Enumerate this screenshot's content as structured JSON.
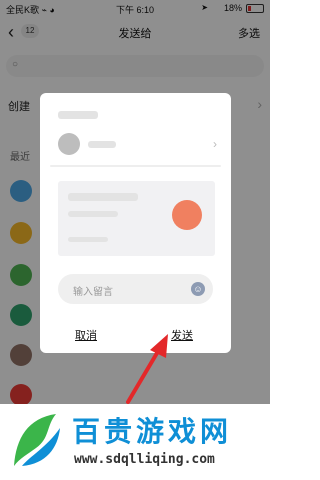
{
  "status_bar": {
    "carrier": "全民K歌 ⌁ ◕",
    "time": "下午 6:10",
    "battery": "18%"
  },
  "nav": {
    "back_icon": "chevron-left-icon",
    "badge_count": "12",
    "title": "发送给",
    "multi_select": "多选"
  },
  "list": {
    "create_label": "创建",
    "recent_label": "最近",
    "avatar_colors": [
      "#4aa3df",
      "#f0b429",
      "#4caf50",
      "#2e9e6a",
      "#8d6e63",
      "#e53935"
    ]
  },
  "dialog": {
    "message_placeholder": "输入留言",
    "cancel_label": "取消",
    "send_label": "发送"
  },
  "watermark": {
    "title": "百贵游戏网",
    "url": "www.sdqlliqing.com"
  },
  "colors": {
    "arrow": "#e3282a",
    "brand_blue": "#0f8fd6",
    "logo_green": "#3bb54a"
  }
}
